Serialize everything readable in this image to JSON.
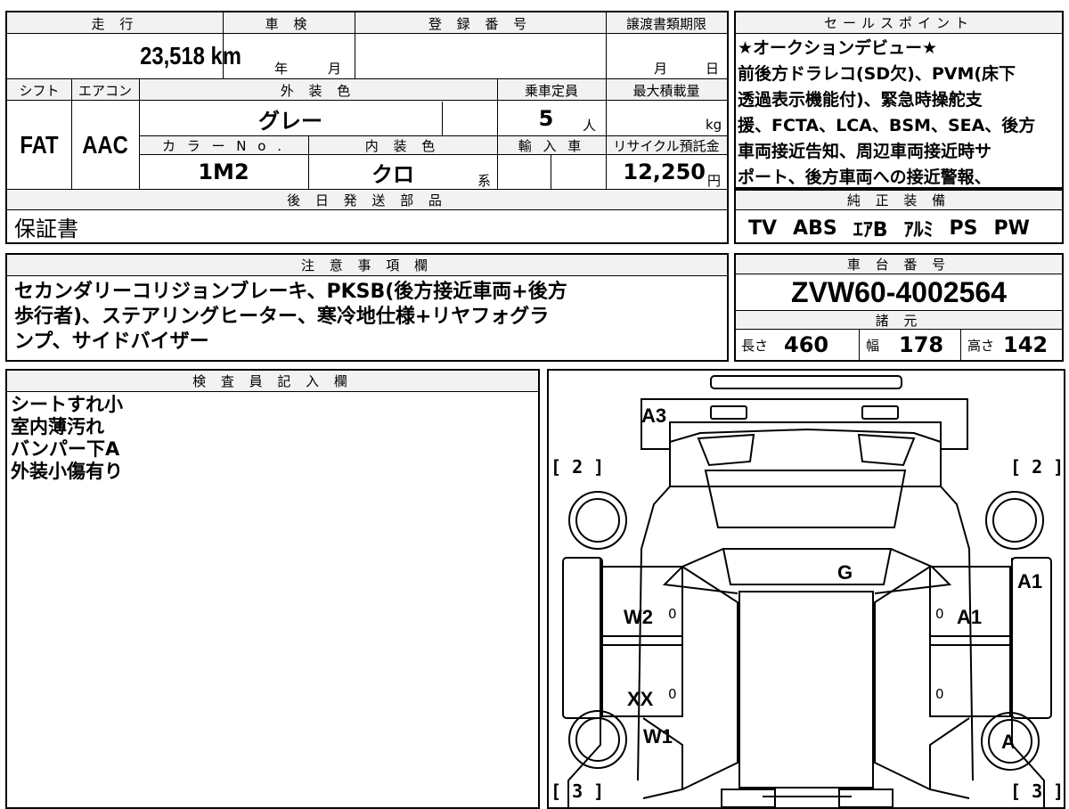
{
  "info": {
    "mileage_label": "走 行",
    "mileage": "23,518 km",
    "inspection_label": "車 検",
    "inspection_year_unit": "年",
    "inspection_month_unit": "月",
    "registration_label": "登 録 番 号",
    "transfer_label": "譲渡書類期限",
    "transfer_month_unit": "月",
    "transfer_day_unit": "日",
    "shift_label": "シフト",
    "shift": "FAT",
    "aircon_label": "エアコン",
    "aircon": "AAC",
    "exterior_color_label": "外 装 色",
    "exterior_color": "グレー",
    "capacity_label": "乗車定員",
    "capacity": "5",
    "capacity_unit": "人",
    "max_load_label": "最大積載量",
    "max_load_unit": "kg",
    "color_no_label": "カ ラ ー N o .",
    "color_no": "1M2",
    "interior_color_label": "内 装 色",
    "interior_color": "クロ",
    "interior_suffix": "系",
    "import_label": "輸 入 車",
    "recycle_label": "リサイクル預託金",
    "recycle_fee": "12,250",
    "recycle_unit": "円",
    "later_parts_label": "後 日 発 送 部 品",
    "later_parts": "保証書"
  },
  "sales": {
    "label": "セールスポイント",
    "lines": [
      "★オークションデビュー★",
      "前後方ドラレコ(SD欠)、PVM(床下",
      "透過表示機能付)、緊急時操舵支",
      "援、FCTA、LCA、BSM、SEA、後方",
      "車両接近告知、周辺車両接近時サ",
      "ポート、後方車両への接近警報、"
    ]
  },
  "equipment": {
    "label": "純 正 装 備",
    "items": [
      "TV",
      "ABS",
      "ｴｱB",
      "ｱﾙﾐ",
      "PS",
      "PW"
    ]
  },
  "notes": {
    "label": "注 意 事 項 欄",
    "lines": [
      "セカンダリーコリジョンブレーキ、PKSB(後方接近車両+後方",
      "歩行者)、ステアリングヒーター、寒冷地仕様+リヤフォグラ",
      "ンプ、サイドバイザー"
    ]
  },
  "chassis": {
    "label": "車 台 番 号",
    "number": "ZVW60-4002564"
  },
  "specs": {
    "label": "諸 元",
    "length_label": "長さ",
    "length": "460",
    "width_label": "幅",
    "width": "178",
    "height_label": "高さ",
    "height": "142"
  },
  "inspector": {
    "label": "検 査 員 記 入 欄",
    "lines": [
      "シートすれ小",
      "室内薄汚れ",
      "バンパー下A",
      "外装小傷有り"
    ]
  },
  "diagram": {
    "marks": {
      "rear_bumper": "A3",
      "roof": "G",
      "right_front_fender": "A1",
      "right_front_door": "A1",
      "left_front_door": "W2",
      "left_rear_door": "XX",
      "left_rear_quarter": "W1",
      "right_rear_wheel": "A"
    },
    "brackets": {
      "top_left": "[ 2 ]",
      "top_right": "[ 2 ]",
      "bottom_left": "[ 3 ]",
      "bottom_right": "[ 3 ]"
    },
    "zero_marks": [
      "0",
      "0",
      "0",
      "0"
    ]
  }
}
